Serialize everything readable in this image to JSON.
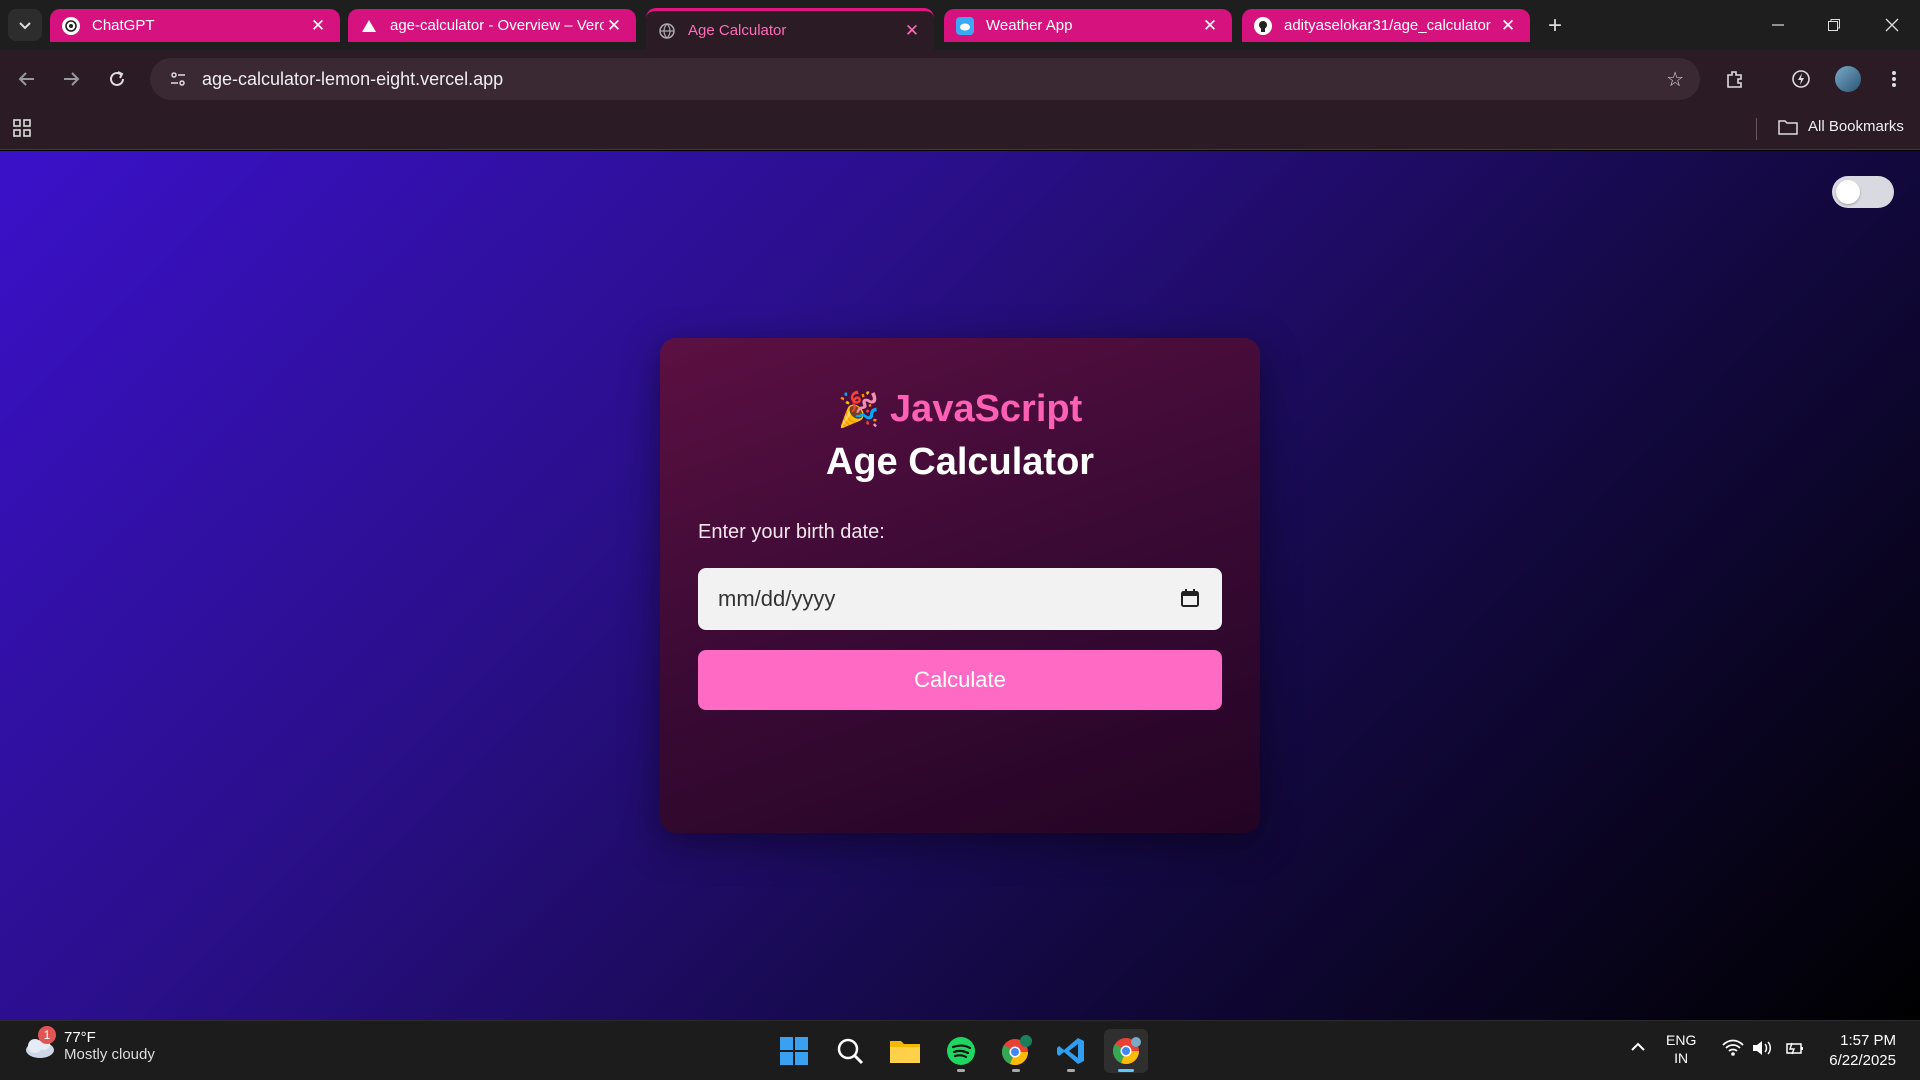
{
  "browser": {
    "tabs": [
      {
        "title": "ChatGPT",
        "active": false
      },
      {
        "title": "age-calculator - Overview – Vercel",
        "active": false
      },
      {
        "title": "Age Calculator",
        "active": true
      },
      {
        "title": "Weather App",
        "active": false
      },
      {
        "title": "adityaselokar31/age_calculator",
        "active": false
      }
    ],
    "url": "age-calculator-lemon-eight.vercel.app",
    "bookmarks_label": "All Bookmarks",
    "accent_color": "#d6127f"
  },
  "page": {
    "heading_emoji": "🎉",
    "heading_line1": "JavaScript",
    "heading_line2": "Age Calculator",
    "birth_label": "Enter your birth date:",
    "date_placeholder": "mm/dd/yyyy",
    "calculate_label": "Calculate",
    "theme_toggle_on": false,
    "colors": {
      "accent": "#ff5fb4",
      "button": "#ff6bc4"
    }
  },
  "taskbar": {
    "weather_alert_count": "1",
    "weather_temp": "77°F",
    "weather_desc": "Mostly cloudy",
    "language_line1": "ENG",
    "language_line2": "IN",
    "time": "1:57 PM",
    "date": "6/22/2025",
    "apps": [
      "windows-start",
      "search",
      "file-explorer",
      "spotify",
      "chrome-profile",
      "vscode",
      "chrome"
    ]
  }
}
